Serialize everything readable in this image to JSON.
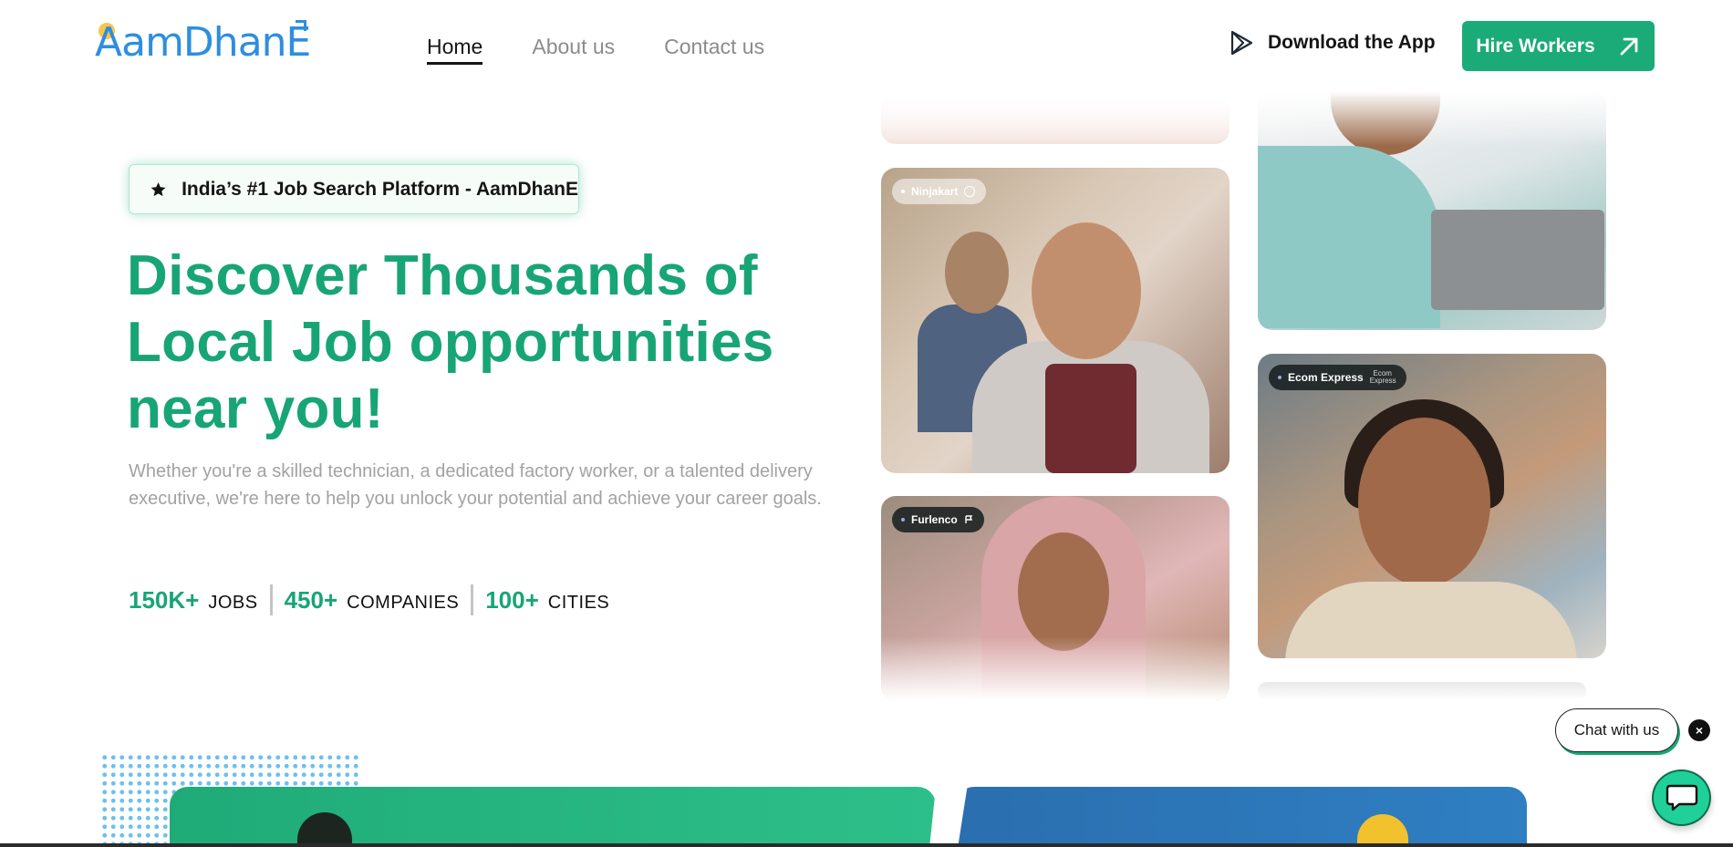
{
  "brand": {
    "logo_text": "AamDhanE",
    "accent_color": "#18a575",
    "logo_color": "#2e8ee0"
  },
  "nav": {
    "items": [
      {
        "label": "Home",
        "active": true
      },
      {
        "label": "About us",
        "active": false
      },
      {
        "label": "Contact us",
        "active": false
      }
    ]
  },
  "header": {
    "download_label": "Download the App",
    "download_icon": "play-store-icon",
    "hire_label": "Hire Workers",
    "hire_icon": "arrow-up-right-icon"
  },
  "hero": {
    "badge_text": "India’s #1 Job Search Platform - AamDhanE",
    "badge_icon": "star-icon",
    "title_lines": [
      "Discover Thousands of",
      "Local Job opportunities",
      "near you!"
    ],
    "description": "Whether you're a skilled technician, a dedicated factory worker, or a talented delivery executive, we're here to help you unlock your potential and achieve your career goals.",
    "stats": [
      {
        "value": "150K+",
        "label": "JOBS"
      },
      {
        "value": "450+",
        "label": "COMPANIES"
      },
      {
        "value": "100+",
        "label": "CITIES"
      }
    ]
  },
  "photos": {
    "tags": [
      {
        "company": "Ninjakart"
      },
      {
        "company": "Ecom Express",
        "brand_mark": "Ecom Express"
      },
      {
        "company": "Furlenco"
      }
    ]
  },
  "chat": {
    "pill_label": "Chat with us",
    "close_label": "×",
    "fab_icon": "chat-bubble-icon"
  }
}
